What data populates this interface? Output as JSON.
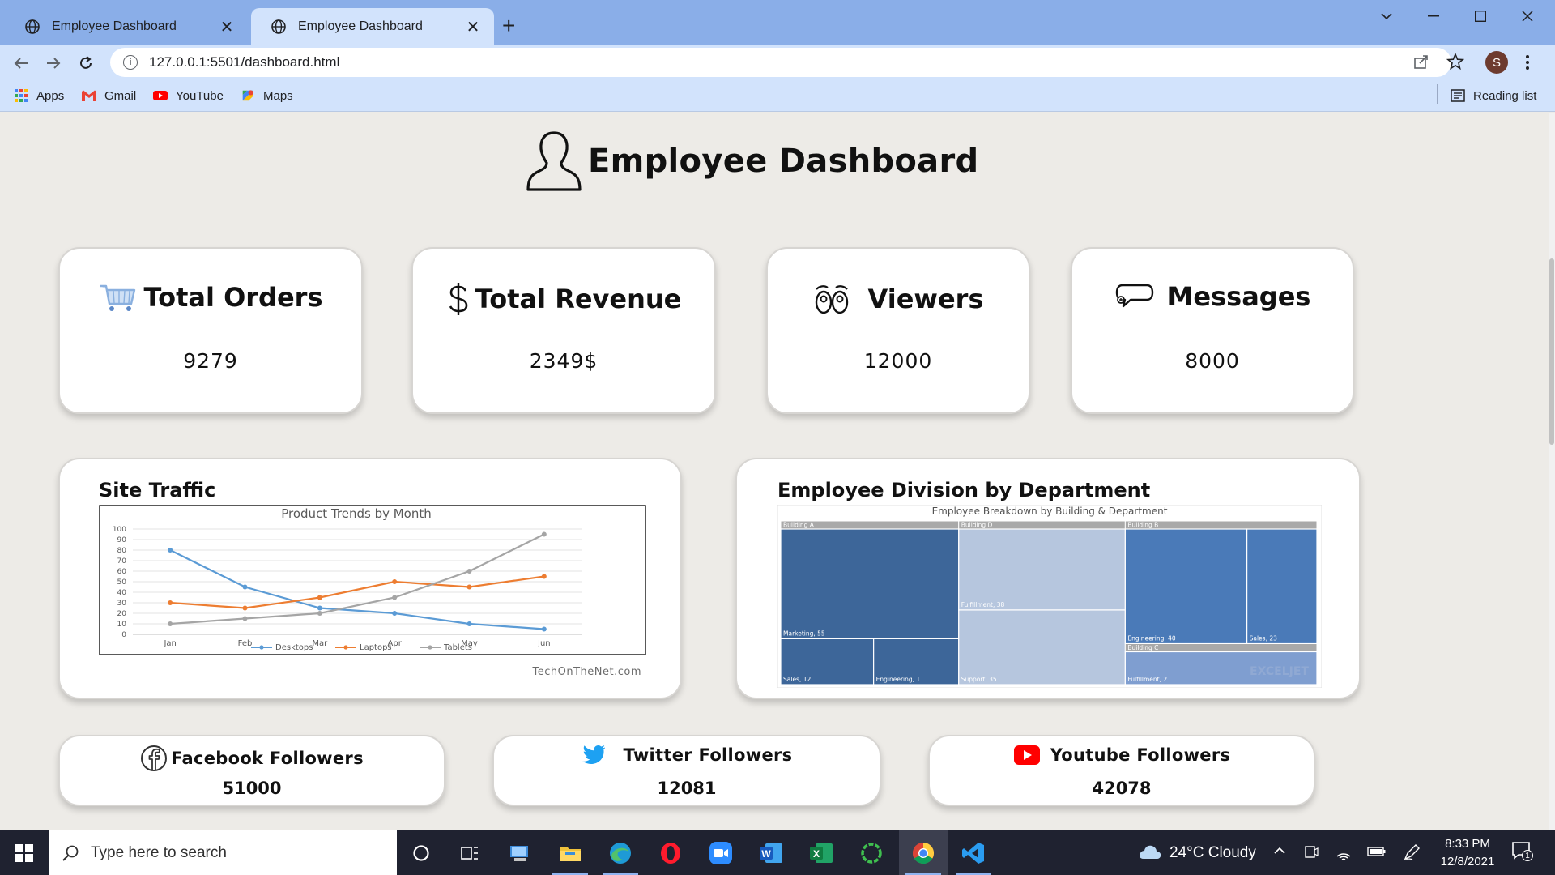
{
  "browser": {
    "tabs": [
      {
        "title": "Employee Dashboard"
      },
      {
        "title": "Employee Dashboard"
      }
    ],
    "url": "127.0.0.1:5501/dashboard.html",
    "profile_initial": "S",
    "bookmarks": [
      "Apps",
      "Gmail",
      "YouTube",
      "Maps"
    ],
    "reading_list": "Reading list"
  },
  "page": {
    "title": "Employee Dashboard",
    "stats": [
      {
        "label": "Total Orders",
        "value": "9279",
        "icon": "cart-icon"
      },
      {
        "label": "Total Revenue",
        "value": "2349$",
        "icon": "dollar-icon"
      },
      {
        "label": "Viewers",
        "value": "12000",
        "icon": "eyes-icon"
      },
      {
        "label": "Messages",
        "value": "8000",
        "icon": "chat-bubble-icon"
      }
    ],
    "site_traffic": {
      "title": "Site Traffic"
    },
    "division": {
      "title": "Employee Division by Department"
    },
    "followers": [
      {
        "label": "Facebook Followers",
        "value": "51000",
        "icon": "facebook-icon"
      },
      {
        "label": "Twitter Followers",
        "value": "12081",
        "icon": "twitter-icon"
      },
      {
        "label": "Youtube Followers",
        "value": "42078",
        "icon": "youtube-icon"
      }
    ]
  },
  "chart_data": [
    {
      "type": "line",
      "title": "Product Trends by Month",
      "source": "TechOnTheNet.com",
      "categories": [
        "Jan",
        "Feb",
        "Mar",
        "Apr",
        "May",
        "Jun"
      ],
      "yticks": [
        0,
        10,
        20,
        30,
        40,
        50,
        60,
        70,
        80,
        90,
        100
      ],
      "ylim": [
        0,
        100
      ],
      "legend": "bottom",
      "series": [
        {
          "name": "Desktops",
          "color": "#5b9bd5",
          "values": [
            80,
            45,
            25,
            20,
            10,
            5
          ]
        },
        {
          "name": "Laptops",
          "color": "#ed7d31",
          "values": [
            30,
            25,
            35,
            50,
            45,
            55
          ]
        },
        {
          "name": "Tablets",
          "color": "#a5a5a5",
          "values": [
            10,
            15,
            20,
            35,
            60,
            95
          ]
        }
      ]
    },
    {
      "type": "treemap",
      "title": "Employee Breakdown by Building & Department",
      "watermark": "EXCELJET",
      "groups": [
        {
          "name": "Building A",
          "items": [
            {
              "label": "Marketing, 55",
              "value": 55,
              "color": "#3d6699"
            },
            {
              "label": "Sales, 12",
              "value": 12,
              "color": "#3d6699"
            },
            {
              "label": "Engineering, 11",
              "value": 11,
              "color": "#3d6699"
            }
          ]
        },
        {
          "name": "Building D",
          "items": [
            {
              "label": "Fulfillment, 38",
              "value": 38,
              "color": "#b6c6de"
            },
            {
              "label": "Support, 35",
              "value": 35,
              "color": "#b6c6de"
            }
          ]
        },
        {
          "name": "Building B",
          "items": [
            {
              "label": "Engineering, 40",
              "value": 40,
              "color": "#4a7ab8"
            },
            {
              "label": "Sales, 23",
              "value": 23,
              "color": "#4a7ab8"
            }
          ]
        },
        {
          "name": "Building C",
          "items": [
            {
              "label": "Fulfillment, 21",
              "value": 21,
              "color": "#7f9ed0"
            }
          ]
        }
      ]
    }
  ],
  "taskbar": {
    "search_placeholder": "Type here to search",
    "weather": "24°C  Cloudy",
    "time": "8:33 PM",
    "date": "12/8/2021",
    "notifications": "1"
  }
}
